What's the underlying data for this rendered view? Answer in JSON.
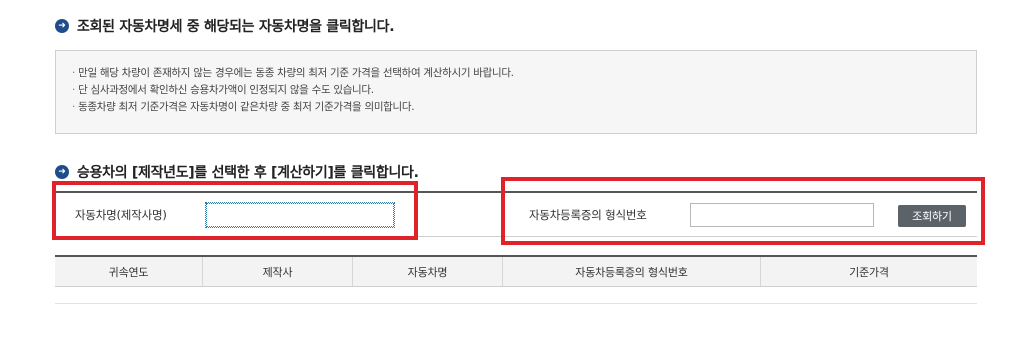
{
  "step1": {
    "heading": "조회된 자동차명세 중 해당되는 자동차명을 클릭합니다."
  },
  "notice": {
    "items": [
      "만일 해당 차량이 존재하지 않는 경우에는 동종 차량의 최저 기준 가격을 선택하여 계산하시기 바랍니다.",
      "단 심사과정에서 확인하신 승용차가액이 인정되지 않을 수도 있습니다.",
      "동종차량 최저 기준가격은 자동차명이 같은차량 중  최저 기준가격을 의미합니다."
    ]
  },
  "step2": {
    "heading": "승용차의 [제작년도]를 선택한 후 [계산하기]를 클릭합니다."
  },
  "search": {
    "name_label": "자동차명(제작사명)",
    "name_value": "",
    "reg_label": "자동차등록증의 형식번호",
    "reg_value": "",
    "button_label": "조회하기"
  },
  "table": {
    "columns": [
      "귀속연도",
      "제작사",
      "자동차명",
      "자동차등록증의 형식번호",
      "기준가격"
    ]
  },
  "colors": {
    "highlight": "#e0222a",
    "bullet": "#1f4d8c",
    "button": "#5b6369"
  }
}
